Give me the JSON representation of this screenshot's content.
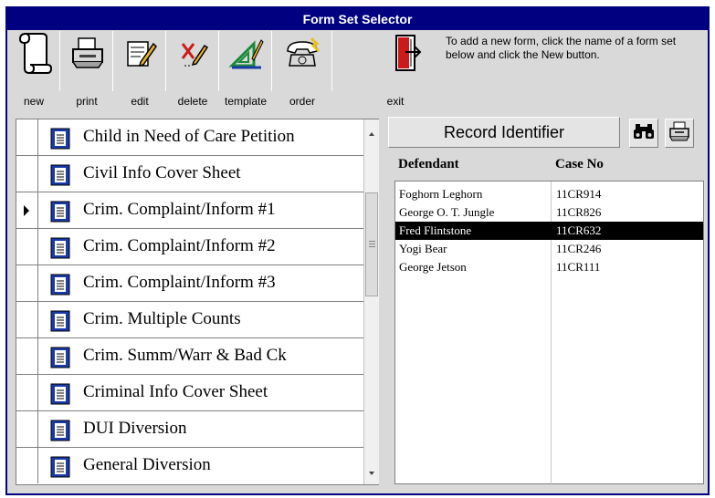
{
  "window": {
    "title": "Form Set Selector"
  },
  "toolbar": {
    "buttons": [
      {
        "label": "new",
        "icon": "scroll-icon"
      },
      {
        "label": "print",
        "icon": "printer-icon"
      },
      {
        "label": "edit",
        "icon": "edit-icon"
      },
      {
        "label": "delete",
        "icon": "delete-icon"
      },
      {
        "label": "template",
        "icon": "template-icon"
      },
      {
        "label": "order",
        "icon": "phone-icon"
      },
      {
        "label": "exit",
        "icon": "exit-door-icon"
      }
    ]
  },
  "help_text": "To add a new form, click the name of a form set below and click the New button.",
  "forms": {
    "items": [
      {
        "label": "Child in Need of Care Petition",
        "selected": false
      },
      {
        "label": "Civil Info Cover Sheet",
        "selected": false
      },
      {
        "label": "Crim. Complaint/Inform #1",
        "selected": true
      },
      {
        "label": "Crim. Complaint/Inform #2",
        "selected": false
      },
      {
        "label": "Crim. Complaint/Inform #3",
        "selected": false
      },
      {
        "label": "Crim. Multiple Counts",
        "selected": false
      },
      {
        "label": "Crim. Summ/Warr & Bad Ck",
        "selected": false
      },
      {
        "label": "Criminal Info Cover Sheet",
        "selected": false
      },
      {
        "label": "DUI Diversion",
        "selected": false
      },
      {
        "label": "General Diversion",
        "selected": false
      }
    ]
  },
  "records": {
    "header": "Record Identifier",
    "columns": [
      "Defendant",
      "Case No"
    ],
    "rows": [
      {
        "defendant": "Foghorn Leghorn",
        "case_no": "11CR914",
        "selected": false
      },
      {
        "defendant": "George O. T. Jungle",
        "case_no": "11CR826",
        "selected": false
      },
      {
        "defendant": "Fred Flintstone",
        "case_no": "11CR632",
        "selected": true
      },
      {
        "defendant": "Yogi Bear",
        "case_no": "11CR246",
        "selected": false
      },
      {
        "defendant": "George Jetson",
        "case_no": "11CR111",
        "selected": false
      }
    ]
  },
  "colors": {
    "title_bar": "#000080",
    "selection": "#000000",
    "exit_red": "#cc1a1a"
  }
}
